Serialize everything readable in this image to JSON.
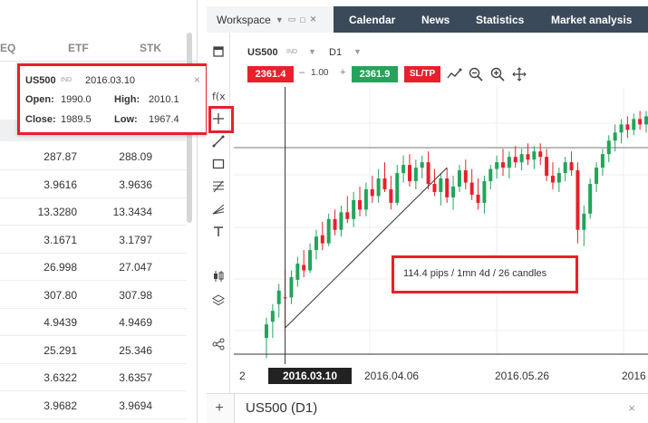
{
  "market_table": {
    "tabs": [
      "EQ",
      "ETF",
      "STK"
    ],
    "rows": [
      {
        "bid": "287.87",
        "ask": "288.09"
      },
      {
        "bid": "3.9616",
        "ask": "3.9636"
      },
      {
        "bid": "13.3280",
        "ask": "13.3434"
      },
      {
        "bid": "3.1671",
        "ask": "3.1797"
      },
      {
        "bid": "26.998",
        "ask": "27.047"
      },
      {
        "bid": "307.80",
        "ask": "307.98"
      },
      {
        "bid": "4.9439",
        "ask": "4.9469"
      },
      {
        "bid": "25.291",
        "ask": "25.346"
      },
      {
        "bid": "3.6322",
        "ask": "3.6357"
      },
      {
        "bid": "3.9682",
        "ask": "3.9694"
      }
    ]
  },
  "info_popup": {
    "symbol": "US500",
    "tag": "IND",
    "date": "2016.03.10",
    "close_glyph": "×",
    "open_label": "Open:",
    "open_value": "1990.0",
    "high_label": "High:",
    "high_value": "2010.1",
    "close_label": "Close:",
    "close_value": "1989.5",
    "low_label": "Low:",
    "low_value": "1967.4"
  },
  "topbar": {
    "workspace": "Workspace",
    "tabs": [
      "Calendar",
      "News",
      "Statistics",
      "Market analysis"
    ]
  },
  "chart_header": {
    "symbol": "US500",
    "tag": "IND",
    "timeframe": "D1",
    "sell_price": "2361.4",
    "quantity": "1.00",
    "buy_price": "2361.9",
    "sltp_label": "SL/TP"
  },
  "annotation": {
    "text": "114.4 pips / 1mn 4d / 26 candles"
  },
  "x_axis": {
    "crosshair_date": "2016.03.10",
    "labels": [
      "2016.04.06",
      "2016.05.26",
      "2016"
    ],
    "left_cut": "2"
  },
  "bottom_tab": {
    "title": "US500 (D1)",
    "close_glyph": "×",
    "add_glyph": "+"
  },
  "colors": {
    "sell": "#e8202c",
    "buy": "#23a45a",
    "topbar": "#3b4a5a",
    "bull": "#23a45a",
    "bear": "#e8202c"
  },
  "chart_data": {
    "type": "candlestick",
    "candles": [
      {
        "o": 1960,
        "h": 1975,
        "l": 1945,
        "c": 1970
      },
      {
        "o": 1972,
        "h": 1985,
        "l": 1960,
        "c": 1980
      },
      {
        "o": 1985,
        "h": 2000,
        "l": 1975,
        "c": 1995
      },
      {
        "o": 1990,
        "h": 2010.1,
        "l": 1967.4,
        "c": 1989.5
      },
      {
        "o": 1990,
        "h": 2010,
        "l": 1985,
        "c": 2005
      },
      {
        "o": 2003,
        "h": 2020,
        "l": 1998,
        "c": 2015
      },
      {
        "o": 2014,
        "h": 2025,
        "l": 2005,
        "c": 2010
      },
      {
        "o": 2010,
        "h": 2030,
        "l": 2008,
        "c": 2025
      },
      {
        "o": 2025,
        "h": 2040,
        "l": 2018,
        "c": 2035
      },
      {
        "o": 2036,
        "h": 2046,
        "l": 2025,
        "c": 2030
      },
      {
        "o": 2030,
        "h": 2052,
        "l": 2028,
        "c": 2048
      },
      {
        "o": 2048,
        "h": 2055,
        "l": 2036,
        "c": 2040
      },
      {
        "o": 2040,
        "h": 2058,
        "l": 2035,
        "c": 2053
      },
      {
        "o": 2053,
        "h": 2065,
        "l": 2045,
        "c": 2048
      },
      {
        "o": 2048,
        "h": 2068,
        "l": 2042,
        "c": 2062
      },
      {
        "o": 2062,
        "h": 2072,
        "l": 2050,
        "c": 2055
      },
      {
        "o": 2055,
        "h": 2075,
        "l": 2050,
        "c": 2070
      },
      {
        "o": 2070,
        "h": 2080,
        "l": 2060,
        "c": 2065
      },
      {
        "o": 2065,
        "h": 2085,
        "l": 2060,
        "c": 2078
      },
      {
        "o": 2078,
        "h": 2090,
        "l": 2068,
        "c": 2070
      },
      {
        "o": 2070,
        "h": 2080,
        "l": 2055,
        "c": 2060
      },
      {
        "o": 2060,
        "h": 2088,
        "l": 2058,
        "c": 2082
      },
      {
        "o": 2082,
        "h": 2095,
        "l": 2075,
        "c": 2088
      },
      {
        "o": 2088,
        "h": 2096,
        "l": 2072,
        "c": 2076
      },
      {
        "o": 2076,
        "h": 2092,
        "l": 2070,
        "c": 2086
      },
      {
        "o": 2086,
        "h": 2095,
        "l": 2078,
        "c": 2090
      },
      {
        "o": 2090,
        "h": 2098,
        "l": 2070,
        "c": 2074
      },
      {
        "o": 2074,
        "h": 2085,
        "l": 2065,
        "c": 2068
      },
      {
        "o": 2068,
        "h": 2082,
        "l": 2058,
        "c": 2078
      },
      {
        "o": 2078,
        "h": 2086,
        "l": 2060,
        "c": 2064
      },
      {
        "o": 2064,
        "h": 2080,
        "l": 2055,
        "c": 2072
      },
      {
        "o": 2072,
        "h": 2088,
        "l": 2068,
        "c": 2084
      },
      {
        "o": 2084,
        "h": 2092,
        "l": 2070,
        "c": 2075
      },
      {
        "o": 2075,
        "h": 2085,
        "l": 2062,
        "c": 2066
      },
      {
        "o": 2066,
        "h": 2078,
        "l": 2055,
        "c": 2060
      },
      {
        "o": 2060,
        "h": 2080,
        "l": 2052,
        "c": 2076
      },
      {
        "o": 2076,
        "h": 2088,
        "l": 2070,
        "c": 2085
      },
      {
        "o": 2085,
        "h": 2095,
        "l": 2078,
        "c": 2090
      },
      {
        "o": 2090,
        "h": 2100,
        "l": 2080,
        "c": 2086
      },
      {
        "o": 2086,
        "h": 2098,
        "l": 2078,
        "c": 2094
      },
      {
        "o": 2094,
        "h": 2102,
        "l": 2086,
        "c": 2090
      },
      {
        "o": 2090,
        "h": 2100,
        "l": 2084,
        "c": 2096
      },
      {
        "o": 2096,
        "h": 2104,
        "l": 2088,
        "c": 2092
      },
      {
        "o": 2092,
        "h": 2102,
        "l": 2085,
        "c": 2098
      },
      {
        "o": 2098,
        "h": 2104,
        "l": 2088,
        "c": 2094
      },
      {
        "o": 2094,
        "h": 2100,
        "l": 2076,
        "c": 2080
      },
      {
        "o": 2080,
        "h": 2090,
        "l": 2070,
        "c": 2075
      },
      {
        "o": 2075,
        "h": 2086,
        "l": 2068,
        "c": 2082
      },
      {
        "o": 2082,
        "h": 2094,
        "l": 2076,
        "c": 2090
      },
      {
        "o": 2090,
        "h": 2098,
        "l": 2080,
        "c": 2084
      },
      {
        "o": 2084,
        "h": 2090,
        "l": 2030,
        "c": 2040
      },
      {
        "o": 2040,
        "h": 2058,
        "l": 2028,
        "c": 2052
      },
      {
        "o": 2052,
        "h": 2078,
        "l": 2048,
        "c": 2074
      },
      {
        "o": 2074,
        "h": 2090,
        "l": 2068,
        "c": 2086
      },
      {
        "o": 2086,
        "h": 2100,
        "l": 2080,
        "c": 2096
      },
      {
        "o": 2096,
        "h": 2110,
        "l": 2090,
        "c": 2106
      },
      {
        "o": 2106,
        "h": 2118,
        "l": 2098,
        "c": 2112
      },
      {
        "o": 2112,
        "h": 2122,
        "l": 2104,
        "c": 2118
      },
      {
        "o": 2118,
        "h": 2124,
        "l": 2108,
        "c": 2114
      },
      {
        "o": 2114,
        "h": 2126,
        "l": 2110,
        "c": 2122
      },
      {
        "o": 2122,
        "h": 2128,
        "l": 2114,
        "c": 2118
      },
      {
        "o": 2118,
        "h": 2128,
        "l": 2112,
        "c": 2124
      }
    ],
    "ylim": [
      1950,
      2135
    ],
    "crosshair_index": 3,
    "measure_start_index": 3,
    "measure_end_index": 29
  }
}
